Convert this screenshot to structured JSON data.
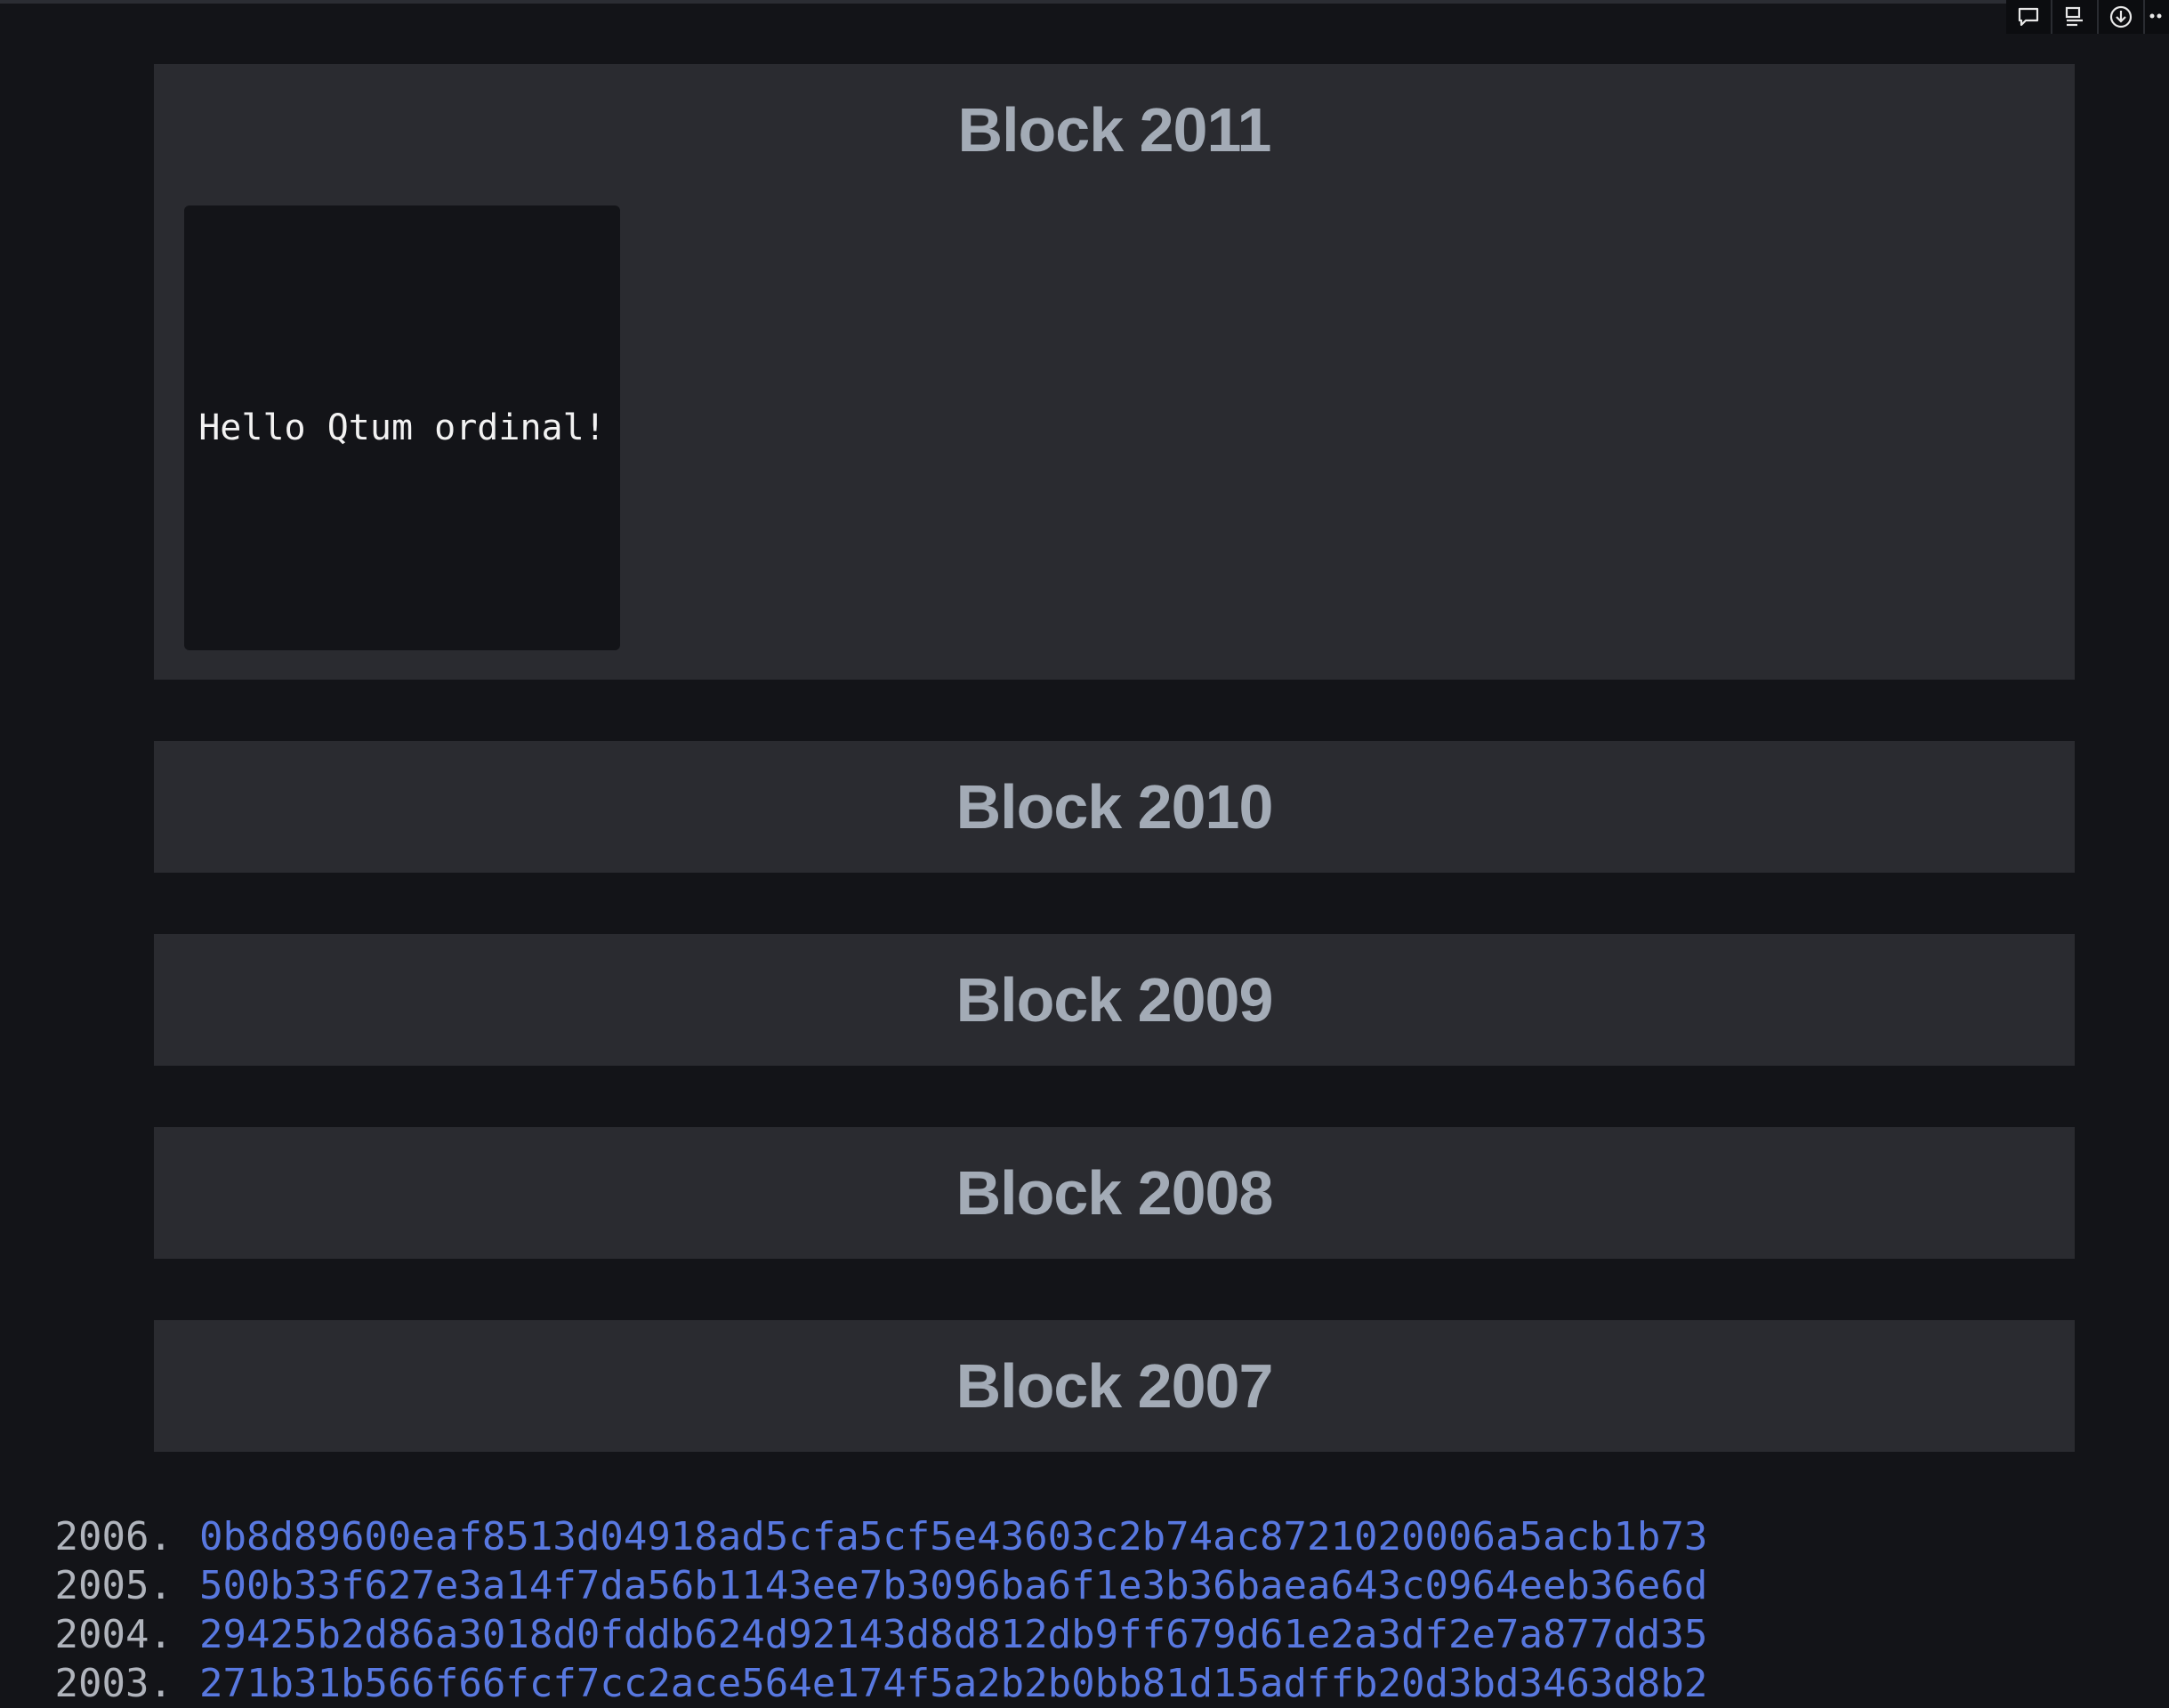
{
  "toolbar": {
    "icons": [
      "comment-icon",
      "layout-icon",
      "download-icon",
      "more-icon"
    ]
  },
  "blocks": [
    {
      "title": "Block 2011",
      "inscription": "Hello Qtum ordinal!"
    },
    {
      "title": "Block 2010"
    },
    {
      "title": "Block 2009"
    },
    {
      "title": "Block 2008"
    },
    {
      "title": "Block 2007"
    }
  ],
  "transactions": [
    {
      "number": "2006.",
      "hash": "0b8d89600eaf8513d04918ad5cfa5cf5e43603c2b74ac8721020006a5acb1b73"
    },
    {
      "number": "2005.",
      "hash": "500b33f627e3a14f7da56b1143ee7b3096ba6f1e3b36baea643c0964eeb36e6d"
    },
    {
      "number": "2004.",
      "hash": "29425b2d86a3018d0fddb624d92143d8d812db9ff679d61e2a3df2e7a877dd35"
    },
    {
      "number": "2003.",
      "hash": "271b31b566f66fcf7cc2ace564e174f5a2b2b0bb81d15adffb20d3bd3463d8b2"
    }
  ],
  "colors": {
    "background": "#131418",
    "panel": "#2a2b30",
    "title": "#a3abb6",
    "link": "#5878e0"
  }
}
